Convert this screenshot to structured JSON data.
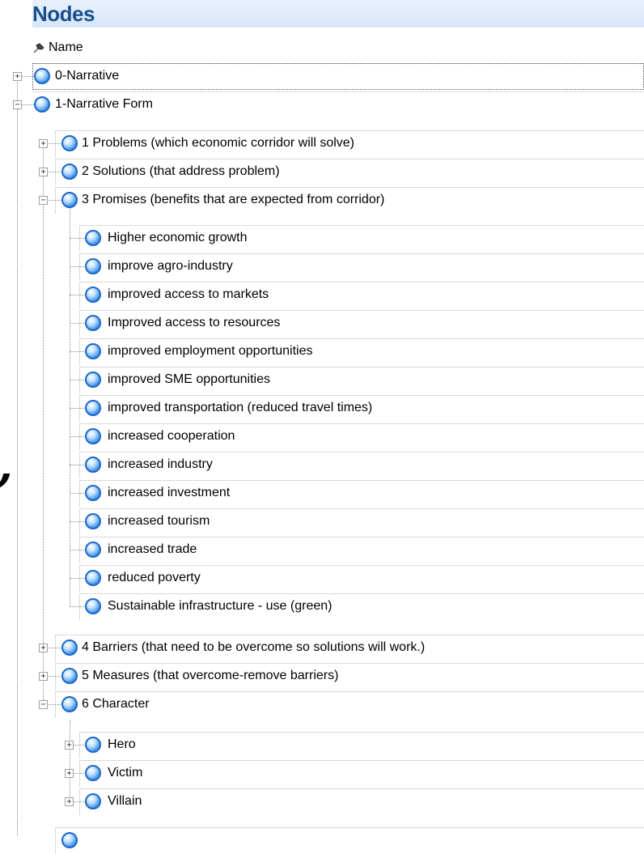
{
  "panel": {
    "title": "Nodes",
    "column_header": "Name",
    "side_mark": ","
  },
  "nodes": [
    {
      "label": "0-Narrative",
      "level": 0,
      "expander": "+"
    },
    {
      "label": "1-Narrative Form",
      "level": 0,
      "expander": "-"
    },
    {
      "label": "1 Problems (which economic corridor will solve)",
      "level": 1,
      "expander": "+"
    },
    {
      "label": "2 Solutions (that address problem)",
      "level": 1,
      "expander": "+"
    },
    {
      "label": "3 Promises (benefits that are expected from corridor)",
      "level": 1,
      "expander": "-"
    },
    {
      "label": "Higher economic growth",
      "level": 2
    },
    {
      "label": "improve agro-industry",
      "level": 2
    },
    {
      "label": "improved access to markets",
      "level": 2
    },
    {
      "label": "Improved access to resources",
      "level": 2
    },
    {
      "label": "improved employment opportunities",
      "level": 2
    },
    {
      "label": "improved SME opportunities",
      "level": 2
    },
    {
      "label": "improved transportation (reduced travel times)",
      "level": 2
    },
    {
      "label": "increased cooperation",
      "level": 2
    },
    {
      "label": "increased industry",
      "level": 2
    },
    {
      "label": "increased investment",
      "level": 2
    },
    {
      "label": "increased tourism",
      "level": 2
    },
    {
      "label": "increased trade",
      "level": 2
    },
    {
      "label": "reduced poverty",
      "level": 2
    },
    {
      "label": "Sustainable infrastructure - use (green)",
      "level": 2
    },
    {
      "label": "4 Barriers (that need to be overcome so solutions will work.)",
      "level": 1,
      "expander": "+"
    },
    {
      "label": "5 Measures (that overcome-remove barriers)",
      "level": 1,
      "expander": "+"
    },
    {
      "label": "6 Character",
      "level": 1,
      "expander": "-"
    },
    {
      "label": "Hero",
      "level": 2,
      "expander": "+"
    },
    {
      "label": "Victim",
      "level": 2,
      "expander": "+"
    },
    {
      "label": "Villain",
      "level": 2,
      "expander": "+"
    }
  ]
}
